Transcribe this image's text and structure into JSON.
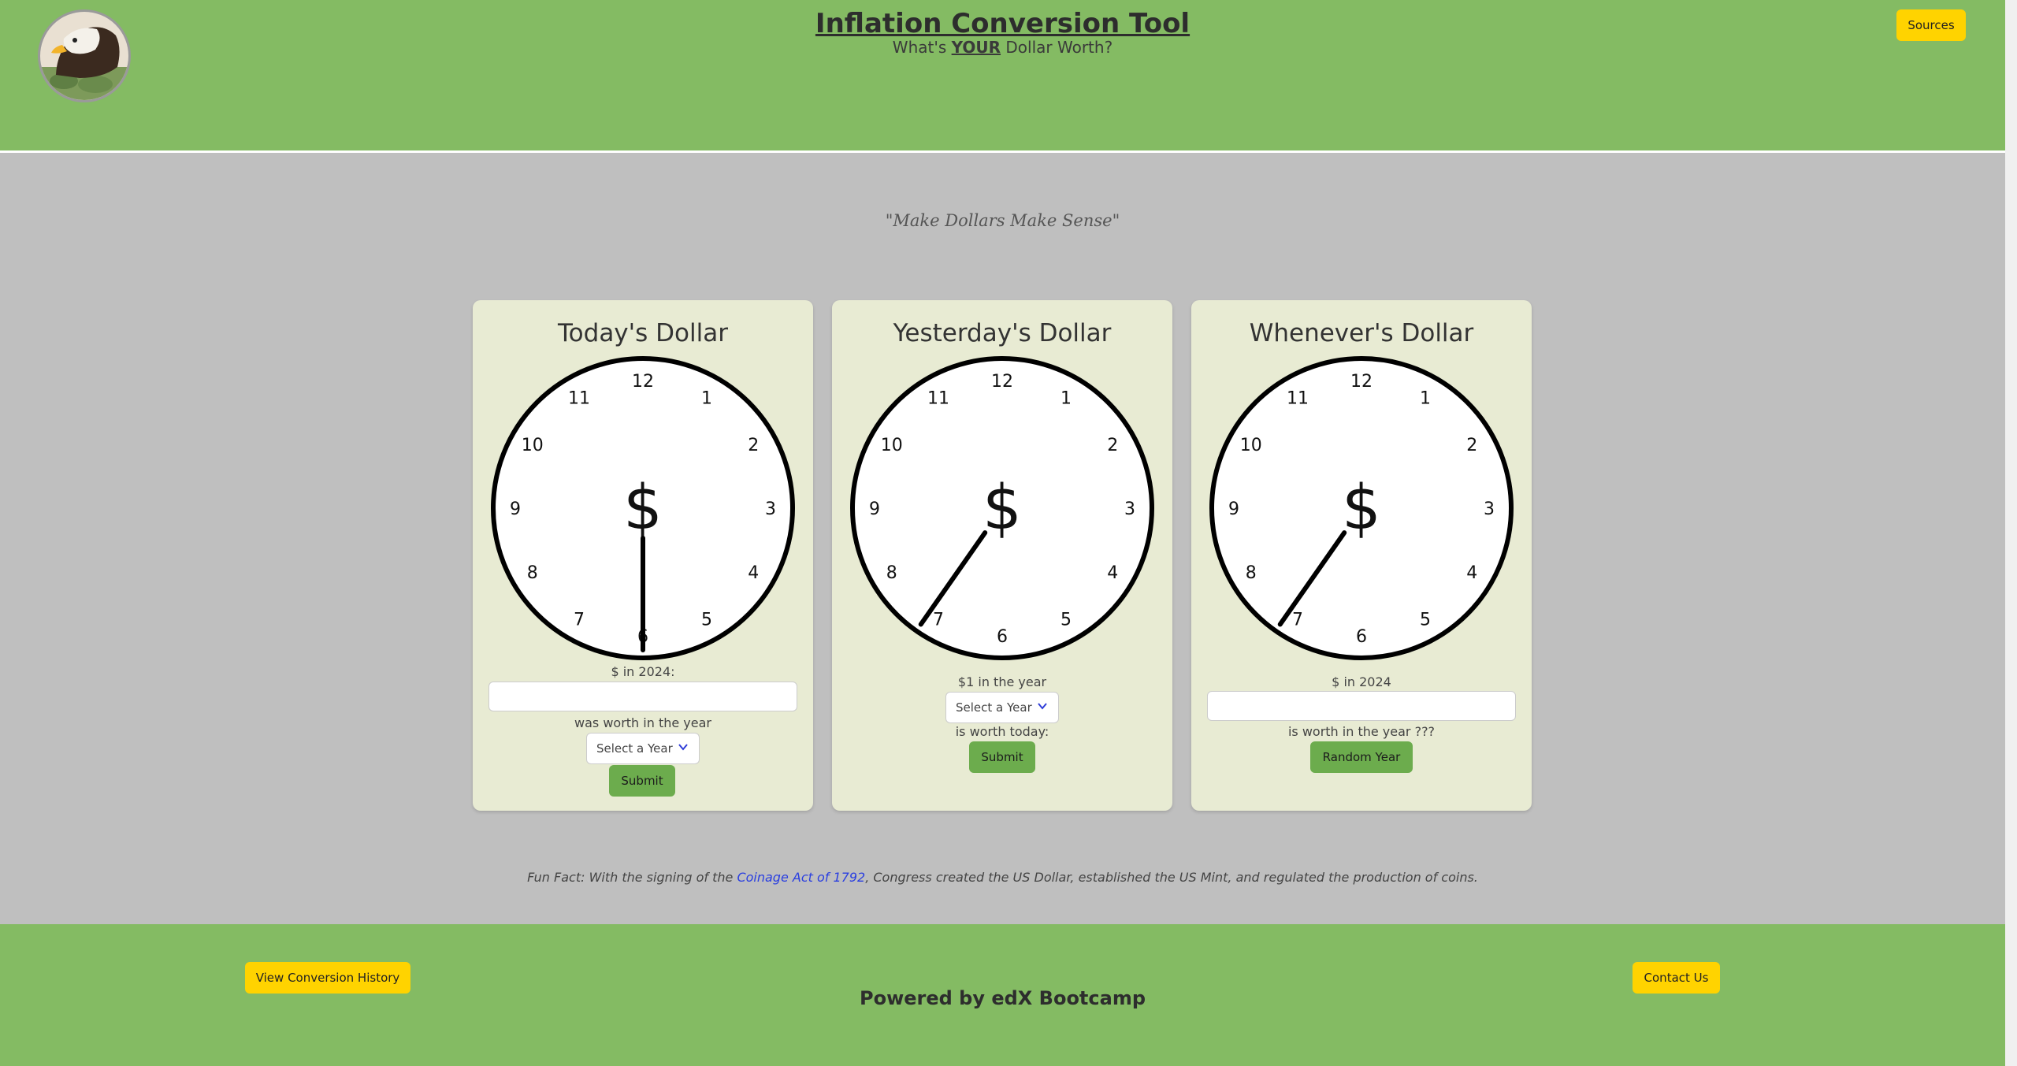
{
  "header": {
    "title": "Inflation Conversion Tool",
    "subtitle_pre": "What's ",
    "subtitle_emph": "YOUR",
    "subtitle_post": " Dollar Worth?",
    "sources_label": "Sources",
    "logo_icon": "bald-eagle-logo-icon"
  },
  "motto": "\"Make Dollars Make Sense\"",
  "clock_numbers": [
    "12",
    "1",
    "2",
    "3",
    "4",
    "5",
    "6",
    "7",
    "8",
    "9",
    "10",
    "11"
  ],
  "clock_symbol": "$",
  "cards": [
    {
      "title": "Today's Dollar",
      "label1": "$ in 2024:",
      "label2": "was worth in the year",
      "select_value": "Select a Year",
      "button": "Submit"
    },
    {
      "title": "Yesterday's Dollar",
      "label1": "$1 in the year",
      "select_value": "Select a Year",
      "label2": "is worth today:",
      "button": "Submit"
    },
    {
      "title": "Whenever's Dollar",
      "label1": "$ in 2024",
      "label2": "is worth in the year ???",
      "button": "Random Year"
    }
  ],
  "fun_fact": {
    "prefix": "Fun Fact: With the signing of the ",
    "link": "Coinage Act of 1792",
    "suffix": ", Congress created the US Dollar, established the US Mint, and regulated the production of coins."
  },
  "footer": {
    "history_label": "View Conversion History",
    "contact_label": "Contact Us",
    "powered": "Powered by edX Bootcamp"
  },
  "colors": {
    "header_bg": "#84bb63",
    "page_bg": "#bfbfbf",
    "card_bg": "#e8ebd3",
    "accent_yellow": "#ffd300",
    "button_green": "#6cac4d",
    "link_blue": "#2a3fe0"
  }
}
